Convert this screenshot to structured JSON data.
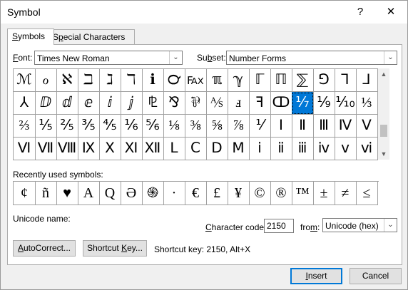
{
  "window": {
    "title": "Symbol",
    "help": "?",
    "close": "✕"
  },
  "tabs": [
    {
      "label": "Symbols",
      "mnemonic": "S",
      "rest": "ymbols"
    },
    {
      "label": "Special Characters",
      "pre": "S",
      "mnemonic": "p",
      "rest": "ecial Characters"
    }
  ],
  "font": {
    "label_mn": "F",
    "label_rest": "ont:",
    "value": "Times New Roman"
  },
  "subset": {
    "label_pre": "Su",
    "label_mn": "b",
    "label_rest": "set:",
    "value": "Number Forms"
  },
  "symbols": [
    [
      "ℳ",
      "ℴ",
      "ℵ",
      "ℶ",
      "ℷ",
      "ℸ",
      "ℹ",
      "℺",
      "℻",
      "ℼ",
      "ℽ",
      "ℾ",
      "ℿ",
      "⅀",
      "⅁",
      "⅂",
      "⅃"
    ],
    [
      "⅄",
      "ⅅ",
      "ⅆ",
      "ⅇ",
      "ⅈ",
      "ⅉ",
      "⅊",
      "⅋",
      "⅌",
      "⅍",
      "ⅎ",
      "ꟻ",
      "ↀ",
      "⅐",
      "⅑",
      "⅒",
      "⅓"
    ],
    [
      "⅔",
      "⅕",
      "⅖",
      "⅗",
      "⅘",
      "⅙",
      "⅚",
      "⅛",
      "⅜",
      "⅝",
      "⅞",
      "⅟",
      "Ⅰ",
      "Ⅱ",
      "Ⅲ",
      "Ⅳ",
      "Ⅴ"
    ],
    [
      "Ⅵ",
      "Ⅶ",
      "Ⅷ",
      "Ⅸ",
      "Ⅹ",
      "Ⅺ",
      "Ⅻ",
      "Ⅼ",
      "Ⅽ",
      "Ⅾ",
      "Ⅿ",
      "ⅰ",
      "ⅱ",
      "ⅲ",
      "ⅳ",
      "ⅴ",
      "ⅵ"
    ]
  ],
  "selected_symbol": "⅐",
  "recent": {
    "label": "Recently used symbols:",
    "items": [
      "¢",
      "ñ",
      "♥",
      "A",
      "Q",
      "Ə",
      "֍",
      "·",
      "€",
      "£",
      "¥",
      "©",
      "®",
      "™",
      "±",
      "≠",
      "≤"
    ]
  },
  "unicode_name": {
    "label": "Unicode name:"
  },
  "char_code": {
    "label_mn": "C",
    "label_rest": "haracter code:",
    "value": "2150"
  },
  "from": {
    "label_pre": "fro",
    "label_mn": "m",
    "label_rest": ":",
    "value": "Unicode (hex)"
  },
  "buttons": {
    "autocorrect": {
      "mn": "A",
      "rest": "utoCorrect..."
    },
    "shortcut": {
      "pre": "Shortcut ",
      "mn": "K",
      "rest": "ey..."
    },
    "insert": {
      "mn": "I",
      "rest": "nsert"
    },
    "cancel": "Cancel"
  },
  "shortcut_text": "Shortcut key: 2150, Alt+X"
}
